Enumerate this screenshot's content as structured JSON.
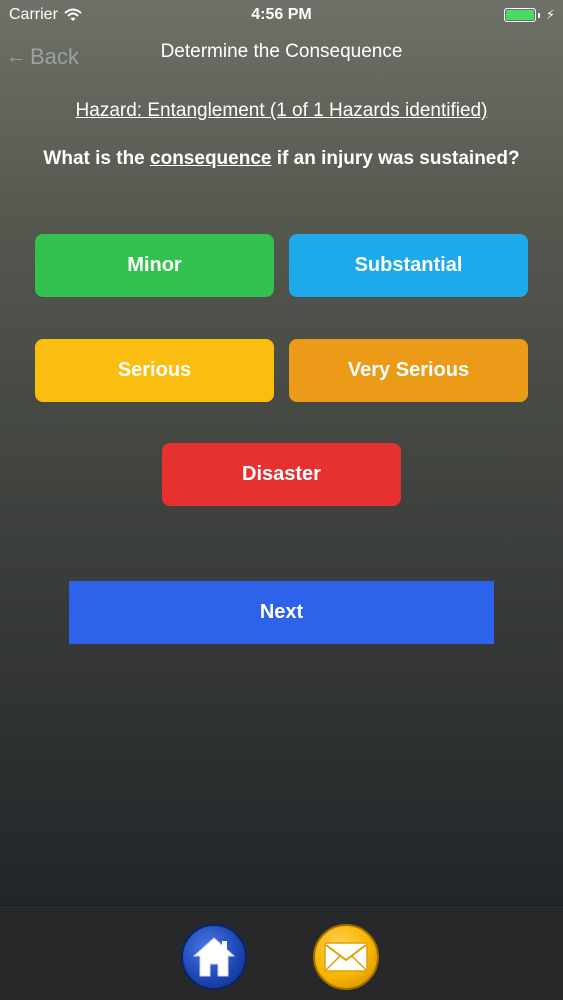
{
  "status_bar": {
    "carrier": "Carrier",
    "time": "4:56 PM",
    "battery_color": "#4cd964"
  },
  "nav": {
    "back_label": "Back",
    "title": "Determine the Consequence"
  },
  "hazard_text": "Hazard: Entanglement (1 of 1 Hazards identified)",
  "question": {
    "prefix": "What is the ",
    "keyword": "consequence",
    "suffix": " if an injury was sustained?"
  },
  "options": {
    "minor": {
      "label": "Minor",
      "color": "#33c24f"
    },
    "substantial": {
      "label": "Substantial",
      "color": "#1ea9ea"
    },
    "serious": {
      "label": "Serious",
      "color": "#fbbd10"
    },
    "very_serious": {
      "label": "Very Serious",
      "color": "#eb9b18"
    },
    "disaster": {
      "label": "Disaster",
      "color": "#e63130"
    }
  },
  "next_label": "Next",
  "tab_bar": {
    "home_icon": "home-icon",
    "mail_icon": "mail-icon"
  }
}
